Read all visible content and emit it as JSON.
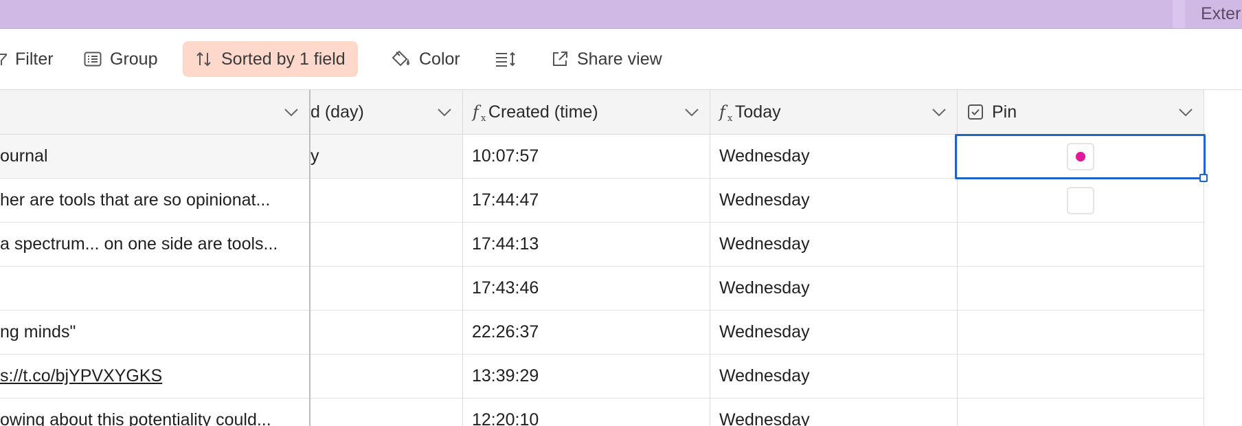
{
  "topbar": {
    "extension_label": "Exter"
  },
  "toolbar": {
    "filter_label": "Filter",
    "group_label": "Group",
    "sort_label": "Sorted by 1 field",
    "color_label": "Color",
    "share_label": "Share view"
  },
  "colors": {
    "topbar": "#d1b9e6",
    "sorted_bg": "#ffd8cc",
    "selection": "#1f63c6",
    "pin_dot": "#e0189a"
  },
  "columns": {
    "col1": {
      "label": ""
    },
    "col2": {
      "label": "d (day)"
    },
    "col3": {
      "label": "Created (time)",
      "icon": "formula-icon"
    },
    "col4": {
      "label": "Today",
      "icon": "formula-icon"
    },
    "col5": {
      "label": "Pin",
      "icon": "checkbox-icon"
    }
  },
  "rows": [
    {
      "c1": "ournal",
      "c2": "y",
      "c3": "10:07:57",
      "c4": "Wednesday",
      "pin": "checked"
    },
    {
      "c1": "her are tools that are so opinionat...",
      "c2": "",
      "c3": "17:44:47",
      "c4": "Wednesday",
      "pin": "empty"
    },
    {
      "c1": " a spectrum... on one side are tools...",
      "c2": "",
      "c3": "17:44:13",
      "c4": "Wednesday",
      "pin": ""
    },
    {
      "c1": "",
      "c2": "",
      "c3": "17:43:46",
      "c4": "Wednesday",
      "pin": ""
    },
    {
      "c1": "ng minds\"",
      "c2": "",
      "c3": "22:26:37",
      "c4": "Wednesday",
      "pin": ""
    },
    {
      "c1": "s://t.co/bjYPVXYGKS",
      "c2": "",
      "c3": "13:39:29",
      "c4": "Wednesday",
      "pin": ""
    },
    {
      "c1": "owing about this potentiality could...",
      "c2": "",
      "c3": "12:20:10",
      "c4": "Wednesday",
      "pin": ""
    }
  ]
}
